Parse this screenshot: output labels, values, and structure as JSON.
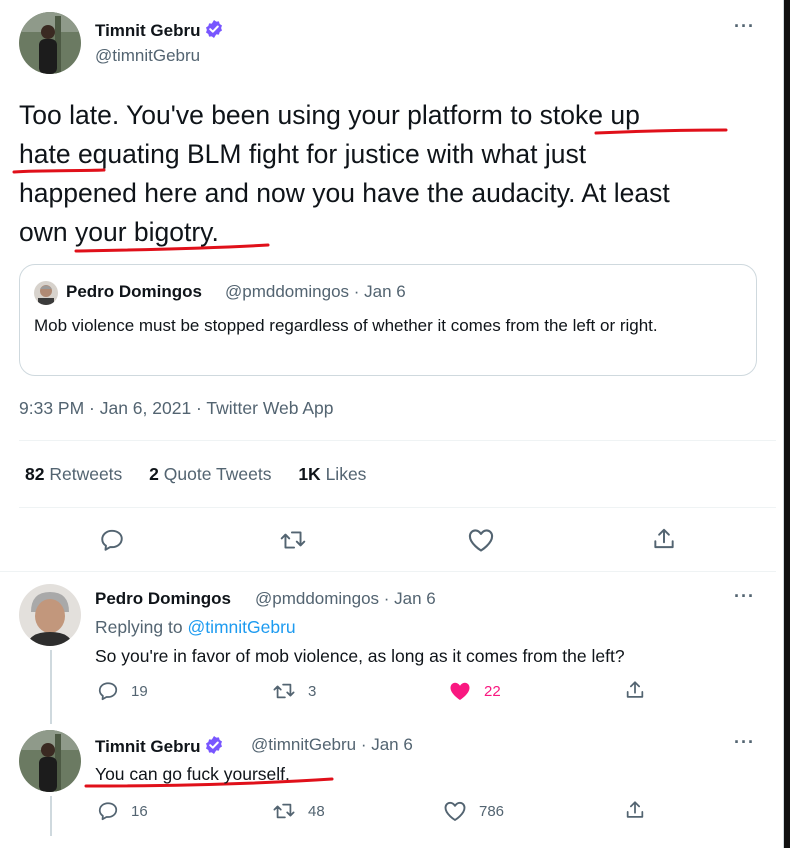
{
  "main_tweet": {
    "author_name": "Timnit Gebru",
    "author_handle": "@timnitGebru",
    "text_line1": "Too late. You've been using your platform to stoke up",
    "text_line2": "hate equating BLM fight for justice with what just",
    "text_line3": "happened here and now you have the audacity. At least",
    "text_line4": "own your bigotry.",
    "more": "···",
    "quoted": {
      "author_name": "Pedro Domingos",
      "author_handle": "@pmddomingos · Jan 6",
      "text": "Mob violence must be stopped regardless of whether it comes from the left or right."
    },
    "meta": "9:33 PM · Jan 6, 2021 · Twitter Web App",
    "stats": {
      "retweets_count": "82",
      "retweets_label": "Retweets",
      "quotes_count": "2",
      "quotes_label": "Quote Tweets",
      "likes_count": "1K",
      "likes_label": "Likes"
    },
    "actions": [
      "reply-icon",
      "retweet-icon",
      "like-icon",
      "share-icon"
    ]
  },
  "replies": [
    {
      "author_name": "Pedro Domingos",
      "author_handle": "@pmddomingos · Jan 6",
      "replying_prefix": "Replying to",
      "replying_to": "@timnitGebru",
      "text": "So you're in favor of mob violence, as long as it comes from the left?",
      "reply_count": "19",
      "retweet_count": "3",
      "like_count": "22",
      "liked": true,
      "more": "···"
    },
    {
      "author_name": "Timnit Gebru",
      "author_handle": "@timnitGebru · Jan 6",
      "text": "You can go fuck yourself.",
      "reply_count": "16",
      "retweet_count": "48",
      "like_count": "786",
      "liked": false,
      "more": "···"
    }
  ],
  "colors": {
    "text": "#0f1419",
    "secondary": "#536471",
    "link": "#1d9bf0",
    "verified": "#7856ff",
    "like_active": "#f91880",
    "ink_underline": "#e0101a"
  }
}
